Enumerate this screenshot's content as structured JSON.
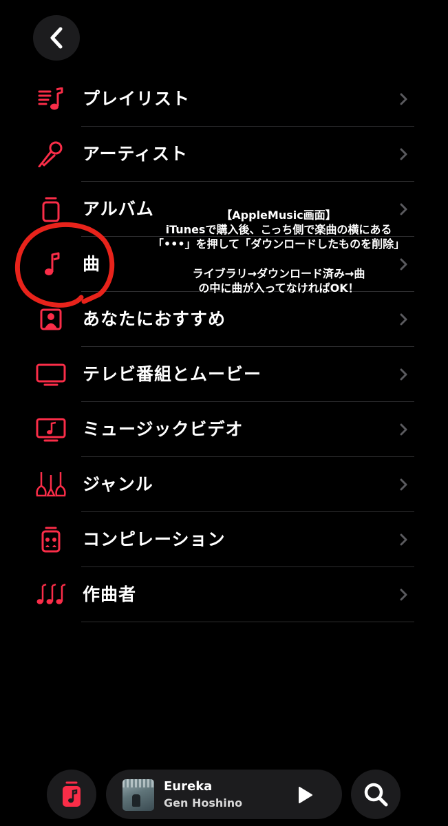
{
  "colors": {
    "accent": "#fa2d48",
    "annotation_circle": "#e8231b",
    "background": "#000000",
    "button_bg": "#1c1c1e"
  },
  "header": {
    "back_icon": "chevron-left-icon"
  },
  "menu": {
    "items": [
      {
        "label": "プレイリスト",
        "icon": "playlist-icon"
      },
      {
        "label": "アーティスト",
        "icon": "microphone-icon"
      },
      {
        "label": "アルバム",
        "icon": "album-icon"
      },
      {
        "label": "曲",
        "icon": "music-note-icon"
      },
      {
        "label": "あなたにおすすめ",
        "icon": "person-square-icon"
      },
      {
        "label": "テレビ番組とムービー",
        "icon": "tv-icon"
      },
      {
        "label": "ミュージックビデオ",
        "icon": "music-video-icon"
      },
      {
        "label": "ジャンル",
        "icon": "guitars-icon"
      },
      {
        "label": "コンピレーション",
        "icon": "compilation-icon"
      },
      {
        "label": "作曲者",
        "icon": "composer-notes-icon"
      }
    ]
  },
  "annotation": {
    "line1": "【AppleMusic画面】",
    "line2": "iTunesで購入後、こっち側で楽曲の横にある",
    "line3": "「•••」を押して「ダウンロードしたものを削除」",
    "line4": "ライブラリ→ダウンロード済み→曲",
    "line5": "の中に曲が入ってなければOK！"
  },
  "now_playing": {
    "title": "Eureka",
    "artist": "Gen Hoshino"
  }
}
